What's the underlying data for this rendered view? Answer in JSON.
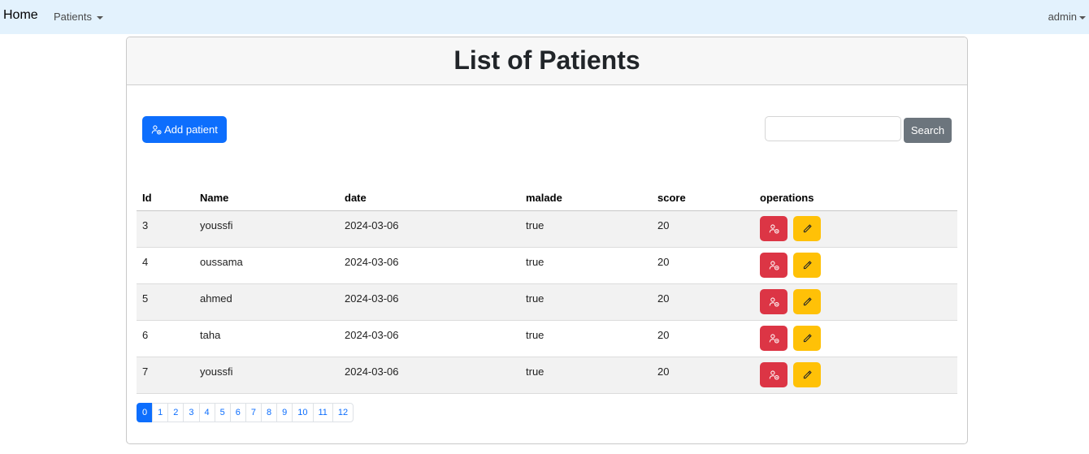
{
  "navbar": {
    "brand": "Home",
    "patients_menu": "Patients",
    "user_menu": "admin"
  },
  "card": {
    "title": "List of Patients",
    "add_button": "Add patient",
    "search_placeholder": "",
    "search_value": "",
    "search_button": "Search"
  },
  "table": {
    "headers": [
      "Id",
      "Name",
      "date",
      "malade",
      "score",
      "operations"
    ],
    "rows": [
      {
        "id": "3",
        "name": "youssfi",
        "date": "2024-03-06",
        "malade": "true",
        "score": "20"
      },
      {
        "id": "4",
        "name": "oussama",
        "date": "2024-03-06",
        "malade": "true",
        "score": "20"
      },
      {
        "id": "5",
        "name": "ahmed",
        "date": "2024-03-06",
        "malade": "true",
        "score": "20"
      },
      {
        "id": "6",
        "name": "taha",
        "date": "2024-03-06",
        "malade": "true",
        "score": "20"
      },
      {
        "id": "7",
        "name": "youssfi",
        "date": "2024-03-06",
        "malade": "true",
        "score": "20"
      }
    ]
  },
  "pagination": {
    "pages": [
      "0",
      "1",
      "2",
      "3",
      "4",
      "5",
      "6",
      "7",
      "8",
      "9",
      "10",
      "11",
      "12"
    ],
    "active": "0"
  },
  "icons": {
    "add": "person-add-icon",
    "delete": "person-remove-icon",
    "edit": "pencil-icon"
  },
  "colors": {
    "navbar_bg": "#e3f2fd",
    "primary": "#0d6efd",
    "secondary": "#6c757d",
    "danger": "#dc3545",
    "warning": "#ffc107"
  }
}
